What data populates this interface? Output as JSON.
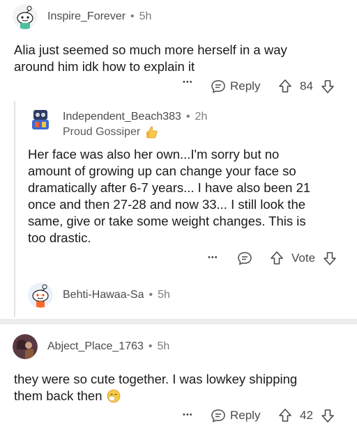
{
  "comments": [
    {
      "username": "Inspire_Forever",
      "separator": "•",
      "time": "5h",
      "text_lines": [
        "Alia just seemed so much more herself in a way",
        "around him idk how to explain it"
      ],
      "more": "•••",
      "reply_label": "Reply",
      "votes": "84"
    },
    {
      "username": "Independent_Beach383",
      "separator": "•",
      "time": "2h",
      "flair": "Proud Gossiper",
      "text_lines": [
        "Her face was also her own...I'm sorry but no",
        "amount of growing up can change your face so",
        "dramatically after 6-7 years... I have also been 21",
        "once and then 27-28 and now 33... I still look the",
        "same, give or take some weight changes. This is",
        "too drastic."
      ],
      "more": "•••",
      "vote_label": "Vote"
    },
    {
      "username": "Behti-Hawaa-Sa",
      "separator": "•",
      "time": "5h"
    },
    {
      "username": "Abject_Place_1763",
      "separator": "•",
      "time": "5h",
      "text_lines": [
        "they were so cute together. I was lowkey shipping",
        "them back then"
      ],
      "more": "•••",
      "reply_label": "Reply",
      "votes": "42"
    }
  ],
  "colors": {
    "text": "#1a1a1b",
    "meta": "#7c7c7c",
    "thread_line": "#e2e2e2",
    "separator": "#eeeeef"
  }
}
